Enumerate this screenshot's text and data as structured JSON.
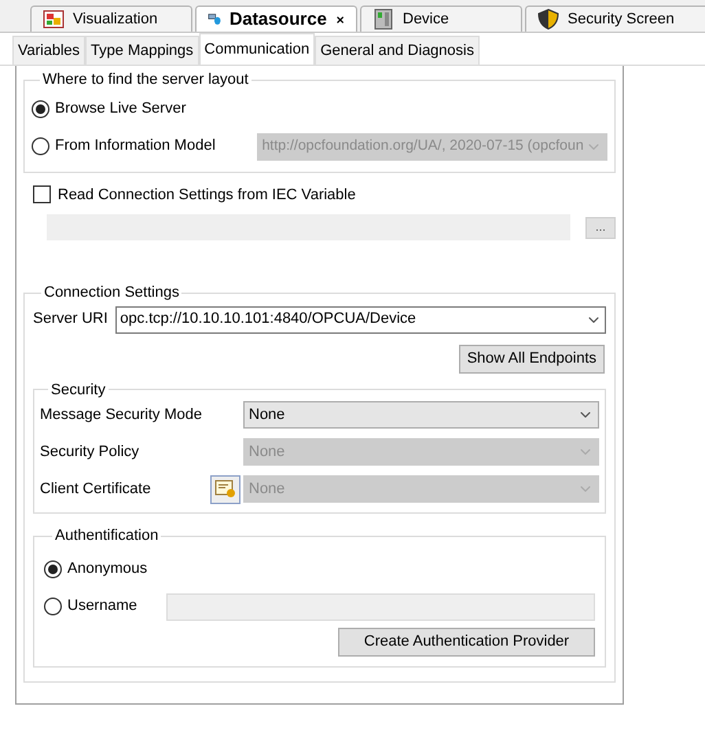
{
  "editor_tabs": [
    {
      "label": "Visualization",
      "selected": false
    },
    {
      "label": "Datasource",
      "selected": true
    },
    {
      "label": "Device",
      "selected": false
    },
    {
      "label": "Security Screen",
      "selected": false
    }
  ],
  "sub_tabs": [
    {
      "label": "Variables",
      "selected": false
    },
    {
      "label": "Type Mappings",
      "selected": false
    },
    {
      "label": "Communication",
      "selected": true
    },
    {
      "label": "General and Diagnosis",
      "selected": false
    }
  ],
  "server_layout": {
    "title": "Where to find the server layout",
    "options": [
      {
        "label": "Browse Live Server",
        "selected": true
      },
      {
        "label": "From Information Model",
        "selected": false
      }
    ],
    "model_dropdown": {
      "value": "http://opcfoundation.org/UA/, 2020-07-15 (opcfoun",
      "disabled": true
    }
  },
  "iec_variable": {
    "label": "Read Connection Settings from IEC Variable",
    "checked": false,
    "field_disabled": true,
    "browse_button": "..."
  },
  "connection": {
    "title": "Connection Settings",
    "server_uri_label": "Server URI",
    "server_uri": "opc.tcp://10.10.10.101:4840/OPCUA/Device",
    "endpoints_button": "Show All Endpoints",
    "security": {
      "title": "Security",
      "rows": [
        {
          "label": "Message Security Mode",
          "value": "None",
          "disabled": false
        },
        {
          "label": "Security Policy",
          "value": "None",
          "disabled": true
        },
        {
          "label": "Client Certificate",
          "value": "None",
          "disabled": true
        }
      ]
    },
    "authentication": {
      "title": "Authentification",
      "options": [
        {
          "label": "Anonymous",
          "selected": true
        },
        {
          "label": "Username",
          "selected": false
        }
      ],
      "username_disabled": true,
      "provider_button": "Create Authentication Provider"
    }
  }
}
